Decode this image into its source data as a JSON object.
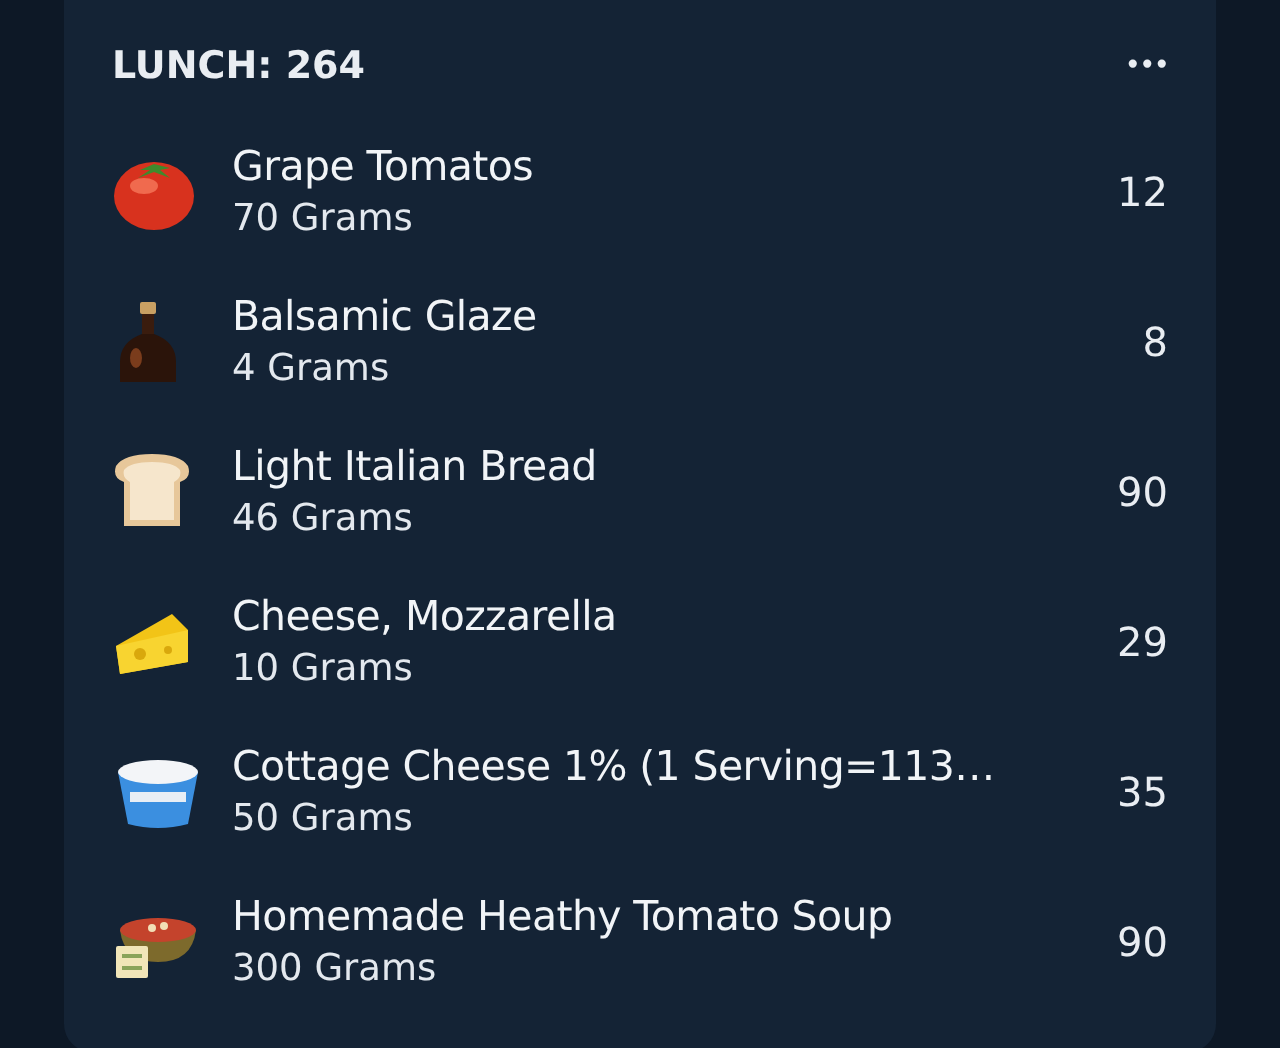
{
  "meal": {
    "title": "LUNCH: 264",
    "menu": "•••"
  },
  "items": [
    {
      "name": "Grape Tomatos",
      "amount": "70 Grams",
      "calories": "12"
    },
    {
      "name": "Balsamic Glaze",
      "amount": "4 Grams",
      "calories": "8"
    },
    {
      "name": "Light Italian Bread",
      "amount": "46 Grams",
      "calories": "90"
    },
    {
      "name": "Cheese, Mozzarella",
      "amount": "10 Grams",
      "calories": "29"
    },
    {
      "name": "Cottage Cheese 1% (1 Serving=113…",
      "amount": "50 Grams",
      "calories": "35"
    },
    {
      "name": "Homemade Heathy Tomato Soup",
      "amount": "300 Grams",
      "calories": "90"
    }
  ]
}
